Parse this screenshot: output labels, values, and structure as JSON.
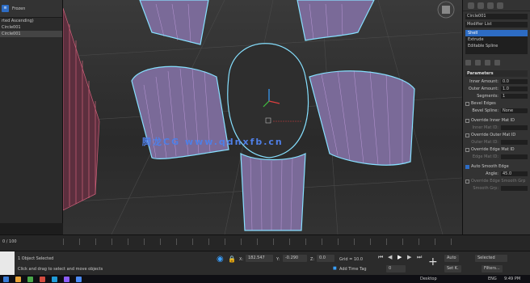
{
  "scene_explorer": {
    "sort_label": "rted Ascending)",
    "frozen_label": "Frozen",
    "items": [
      "Circle001",
      "Circle001"
    ],
    "range_label": "0 / 100"
  },
  "viewport": {
    "watermark": "腾龙CG www.qdnxfb.cn"
  },
  "command_panel": {
    "object_name": "Circle001",
    "modifier_list_label": "Modifier List",
    "stack": [
      "Shell",
      "Extrude",
      "Editable Spline"
    ],
    "rollout_title": "Parameters",
    "params": [
      {
        "label": "Inner Amount:",
        "value": "0.0"
      },
      {
        "label": "Outer Amount:",
        "value": "1.0"
      },
      {
        "label": "Segments:",
        "value": "1"
      }
    ],
    "bevel_edges_label": "Bevel Edges",
    "bevel_spline_label": "Bevel Spline:",
    "bevel_spline_value": "None",
    "override_inner_label": "Override Inner Mat ID",
    "inner_mat_label": "Inner Mat ID:",
    "override_outer_label": "Override Outer Mat ID",
    "outer_mat_label": "Outer Mat ID:",
    "override_edge_label": "Override Edge Mat ID",
    "edge_mat_label": "Edge Mat ID:",
    "auto_smooth_label": "Auto Smooth Edge",
    "angle_label": "Angle:",
    "angle_value": "45.0",
    "override_smooth_label": "Override Edge Smooth Grp",
    "smooth_group_label": "Smooth Grp:"
  },
  "status": {
    "selection": "1 Object Selected",
    "hint": "Click and drag to select and move objects",
    "x_label": "X:",
    "x_value": "182.547",
    "y_label": "Y:",
    "y_value": "-0.290",
    "z_label": "Z:",
    "z_value": "0.0",
    "grid_label": "Grid = 10.0",
    "add_time_tag": "Add Time Tag",
    "frame_value": "0",
    "auto_label": "Auto",
    "selected_label": "Selected",
    "set_key_label": "Set K.",
    "filters_label": "Filters..."
  },
  "taskbar": {
    "desktop_label": "Desktop",
    "lang": "ENG",
    "time": "9:49 PM",
    "colors": [
      "#3a7bd5",
      "#e8a33a",
      "#4aa84a",
      "#d24c3f",
      "#1f9bd7",
      "#8b5cf6",
      "#4c8bf5"
    ]
  },
  "colors": {
    "accent": "#2d6cc4",
    "wire_purple": "#c9a3e6",
    "wire_red": "#d0607a",
    "wire_cyan": "#86e0ff"
  }
}
